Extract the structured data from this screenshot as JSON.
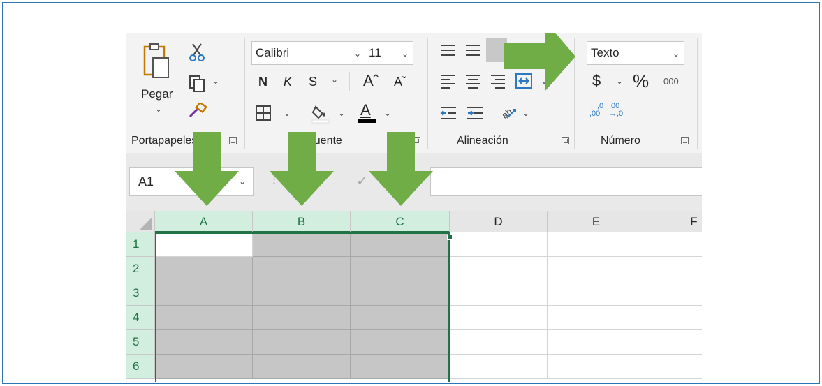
{
  "clipboard": {
    "paste_label": "Pegar",
    "group_label": "Portapapeles"
  },
  "font": {
    "name": "Calibri",
    "size": "11",
    "bold": "N",
    "italic": "K",
    "underline": "S",
    "grow": "Aˆ",
    "shrink": "Aˇ",
    "group_label": "Fuente"
  },
  "alignment": {
    "group_label": "Alineación"
  },
  "number": {
    "format": "Texto",
    "currency": "$",
    "percent": "%",
    "thousands": "000",
    "inc_decimal": "←,0 ,00",
    "dec_decimal": ",00 →,0",
    "group_label": "Número"
  },
  "formula_bar": {
    "name_box": "A1",
    "cancel": "✕",
    "enter": "✓"
  },
  "grid": {
    "columns": [
      "A",
      "B",
      "C",
      "D",
      "E",
      "F"
    ],
    "selected_columns": [
      "A",
      "B",
      "C"
    ],
    "rows": [
      "1",
      "2",
      "3",
      "4",
      "5",
      "6"
    ]
  },
  "colors": {
    "arrow": "#70ad47",
    "excel_green": "#217346",
    "selection_fill": "#c6c6c6",
    "frame": "#2e75b6"
  }
}
